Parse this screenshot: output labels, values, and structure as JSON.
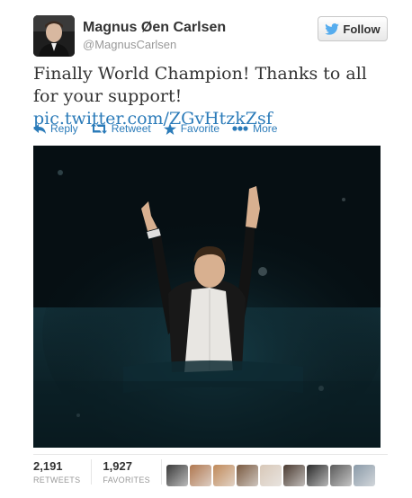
{
  "user": {
    "name": "Magnus Øen Carlsen",
    "handle": "@MagnusCarlsen"
  },
  "follow": {
    "label": "Follow",
    "icon": "twitter-bird-icon"
  },
  "tweet": {
    "text": "Finally World Champion! Thanks to all for your support!",
    "link": "pic.twitter.com/ZGvHtzkZsf"
  },
  "actions": [
    {
      "label": "Reply",
      "icon": "reply-icon"
    },
    {
      "label": "Retweet",
      "icon": "retweet-icon"
    },
    {
      "label": "Favorite",
      "icon": "star-icon"
    },
    {
      "label": "More",
      "icon": "more-dots-icon"
    }
  ],
  "stats": {
    "retweets": {
      "count": "2,191",
      "label": "RETWEETS"
    },
    "favorites": {
      "count": "1,927",
      "label": "FAVORITES"
    }
  },
  "favoriters": [
    "#3a3a3a",
    "#b07850",
    "#c08a5a",
    "#7a5a40",
    "#d8c8b8",
    "#4a3a30",
    "#2a2a2a",
    "#5a5a5a",
    "#8a9aa8"
  ],
  "colors": {
    "link": "#2b7bb9",
    "bird": "#55acee"
  }
}
